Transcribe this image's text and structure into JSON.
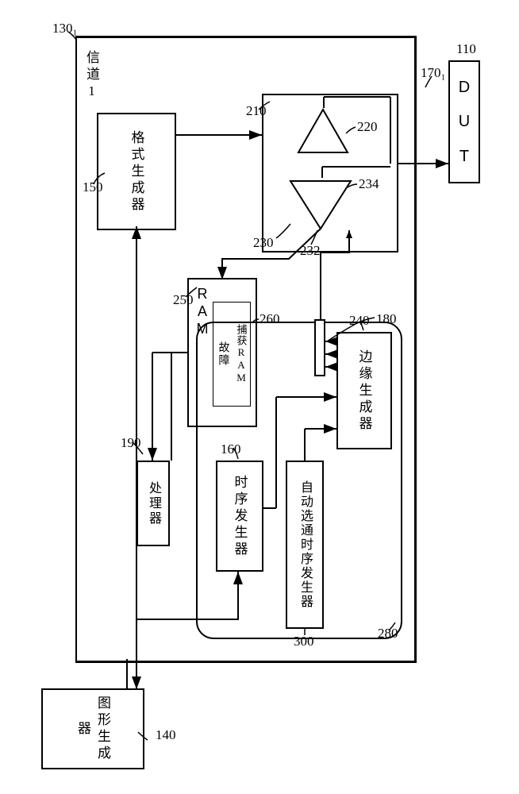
{
  "labels": {
    "channel_ref": "130₁",
    "channel_title": "信道1",
    "pattern_gen_ref": "140",
    "pattern_gen": "图形生成器",
    "format_gen_ref": "150",
    "format_gen": "格式生成器",
    "driver_block_ref": "210",
    "amp_up_ref": "220",
    "amp_down_left_ref": "230",
    "amp_down_mid_ref": "232",
    "amp_down_right_ref": "234",
    "conn_ref": "170₁",
    "dut_ref": "110",
    "dut_d": "D",
    "dut_u": "U",
    "dut_t": "T",
    "ram_ref": "250",
    "ram_label": "RAM",
    "fail_ram_ref": "260",
    "fail_ram_line1": "故障",
    "fail_ram_line2": "捕获RAM",
    "processor_ref": "190",
    "processor": "处理器",
    "edge_block_ref": "180",
    "edge_gen_ref": "240",
    "edge_gen": "边缘生成器",
    "edge_container_ref": "280",
    "timing_gen_ref": "160",
    "timing_gen": "时序发生器",
    "auto_timing_ref": "300",
    "auto_timing": "自动选通时序发生器"
  }
}
